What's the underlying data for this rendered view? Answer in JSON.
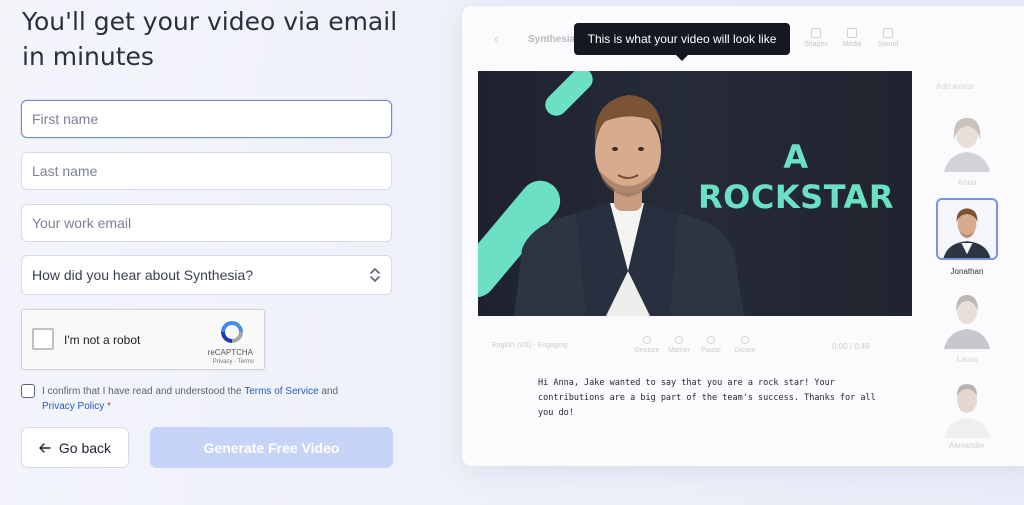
{
  "form": {
    "headline": "You'll get your video via email in minutes",
    "first_name_placeholder": "First name",
    "last_name_placeholder": "Last name",
    "email_placeholder": "Your work email",
    "source_select": "How did you hear about Synthesia?",
    "captcha": {
      "label": "I'm not a robot",
      "brand": "reCAPTCHA",
      "links": "Privacy - Terms"
    },
    "consent": {
      "prefix": "I confirm that I have read and understood the",
      "terms_link": "Terms of Service",
      "and": "and",
      "privacy_link": "Privacy Policy",
      "required_mark": "*"
    },
    "back_label": "Go back",
    "generate_label": "Generate Free Video"
  },
  "preview": {
    "tooltip": "This is what your video will look like",
    "title": "Synthesia",
    "tools": [
      "Shapes",
      "Media",
      "Sound"
    ],
    "video_text_line1": "A",
    "video_text_line2": "ROCKSTAR",
    "language": "English (US) - Engaging",
    "mid_tools": [
      "Gesture",
      "Marker",
      "Pause",
      "Diction"
    ],
    "char_count": "0:00 / 0:49",
    "script": "Hi Anna, Jake wanted to say that you are a rock star! Your contributions are a big part of the team's success. Thanks for all you do!",
    "avatars_heading": "Add avatar",
    "avatars": [
      {
        "name": "Anna",
        "selected": false
      },
      {
        "name": "Jonathan",
        "selected": true
      },
      {
        "name": "Laura",
        "selected": false
      },
      {
        "name": "Alexander",
        "selected": false
      }
    ]
  },
  "colors": {
    "accent_teal": "#6ce0c4",
    "link_blue": "#2a5bb8",
    "button_disabled": "#c7d4f8",
    "focus_border": "#6f8ad0"
  }
}
